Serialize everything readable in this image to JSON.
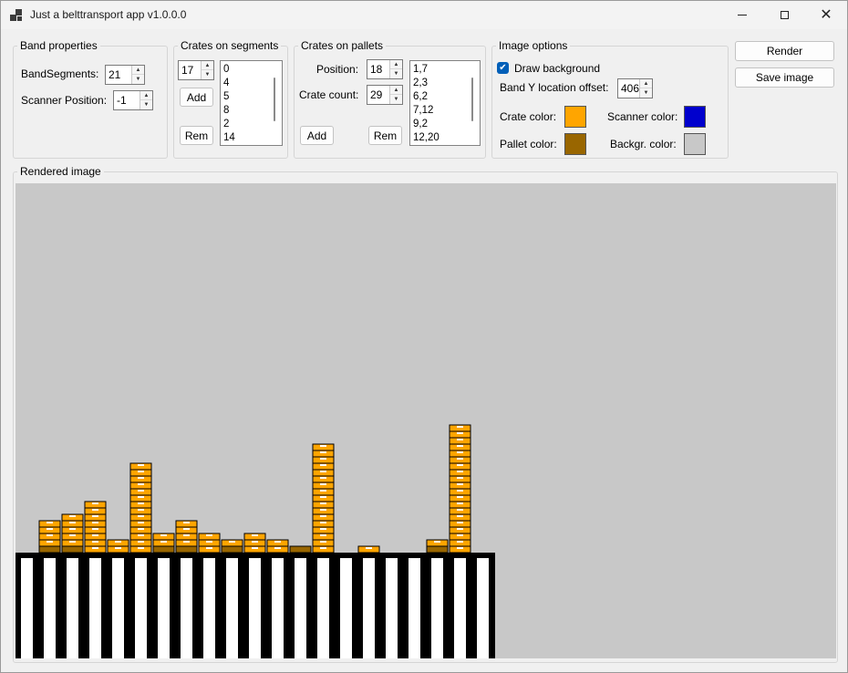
{
  "window": {
    "title": "Just a belttransport app v1.0.0.0"
  },
  "band_properties": {
    "legend": "Band properties",
    "segments_label": "BandSegments:",
    "segments_value": "21",
    "scanner_label": "Scanner Position:",
    "scanner_value": "-1"
  },
  "crates_on_segments": {
    "legend": "Crates on segments",
    "input_value": "17",
    "add_label": "Add",
    "rem_label": "Rem",
    "items": [
      "0",
      "4",
      "5",
      "8",
      "2",
      "14"
    ],
    "values": [
      0,
      4,
      5,
      8,
      2,
      14,
      2,
      4,
      3,
      1,
      3,
      2,
      0,
      17,
      0,
      1,
      0,
      0,
      1,
      20,
      0
    ]
  },
  "crates_on_pallets": {
    "legend": "Crates on pallets",
    "position_label": "Position:",
    "position_value": "18",
    "count_label": "Crate count:",
    "count_value": "29",
    "add_label": "Add",
    "rem_label": "Rem",
    "items": [
      "1,7",
      "2,3",
      "6,2",
      "7,12",
      "9,2",
      "12,20"
    ],
    "pallets": [
      [
        1,
        7
      ],
      [
        2,
        3
      ],
      [
        6,
        2
      ],
      [
        7,
        12
      ],
      [
        9,
        2
      ],
      [
        12,
        20
      ]
    ]
  },
  "image_options": {
    "legend": "Image options",
    "draw_bg_label": "Draw background",
    "draw_bg_checked": true,
    "offset_label": "Band Y location offset:",
    "offset_value": "406",
    "crate_color_label": "Crate color:",
    "scanner_color_label": "Scanner color:",
    "pallet_color_label": "Pallet color:",
    "bg_color_label": "Backgr. color:"
  },
  "colors": {
    "crate": "#ffa500",
    "scanner": "#0000cd",
    "pallet": "#996600",
    "background": "#c8c8c8"
  },
  "actions": {
    "render_label": "Render",
    "save_label": "Save image"
  },
  "rendered": {
    "legend": "Rendered image",
    "crates_per_segment": [
      0,
      4,
      5,
      8,
      2,
      14,
      2,
      4,
      3,
      1,
      3,
      2,
      0,
      17,
      0,
      1,
      0,
      0,
      1,
      20,
      0
    ],
    "pallet_segments": [
      1,
      2,
      6,
      7,
      9,
      12,
      18
    ],
    "loose_crate_segments": [
      0,
      4,
      5,
      8,
      14,
      17
    ]
  }
}
